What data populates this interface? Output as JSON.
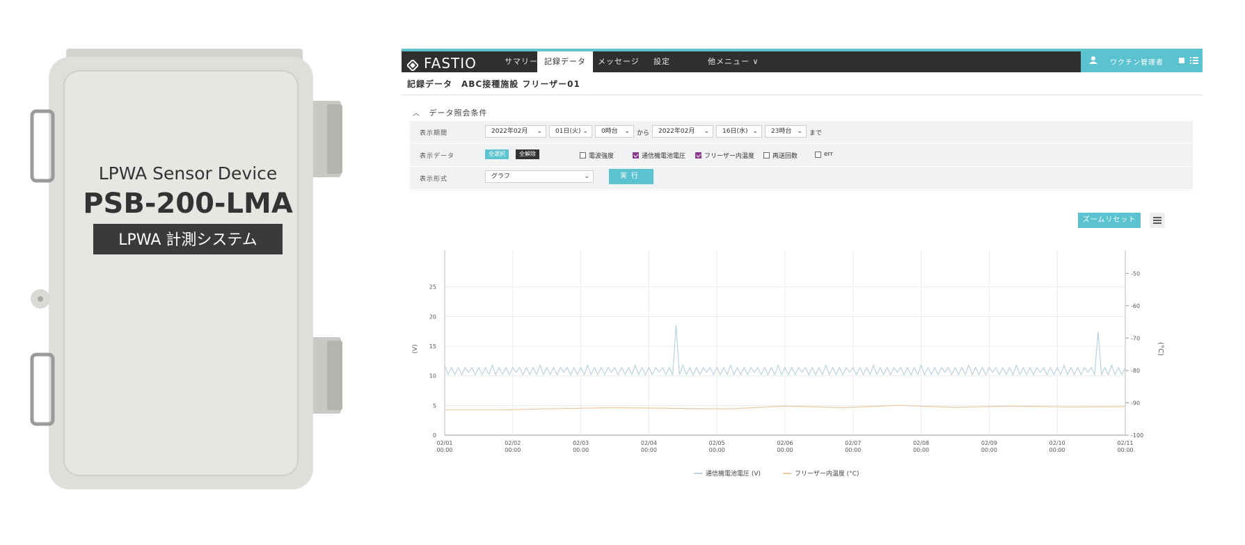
{
  "device": {
    "line1": "LPWA Sensor Device",
    "model": "PSB-200-LMA",
    "banner": "LPWA 計測システム",
    "colors": {
      "body": "#e2e2df",
      "banner": "#3a3a3a"
    }
  },
  "app": {
    "logo": "FASTIO",
    "nav": [
      {
        "label": "サマリー",
        "active": false
      },
      {
        "label": "記録データ",
        "active": true
      },
      {
        "label": "メッセージ",
        "active": false
      },
      {
        "label": "設定",
        "active": false
      },
      {
        "label": "他メニュー ∨",
        "active": false
      }
    ],
    "user": "ワクチン管理者",
    "breadcrumb": "記録データ　ABC接種施設 フリーザー01",
    "conditions_header": "データ照会条件",
    "period": {
      "label": "表示期間",
      "from_month": "2022年02月",
      "from_day": "01日(火)",
      "from_hour": "0時台",
      "from_sep": "から",
      "to_month": "2022年02月",
      "to_day": "16日(水)",
      "to_hour": "23時台",
      "to_sep": "まで"
    },
    "data_row": {
      "label": "表示データ",
      "select_all": "全選択",
      "clear_all": "全解除",
      "checks": [
        {
          "label": "電波強度",
          "checked": false
        },
        {
          "label": "通信機電池電圧",
          "checked": true
        },
        {
          "label": "フリーザー内温度",
          "checked": true
        },
        {
          "label": "再送回数",
          "checked": false
        },
        {
          "label": "err",
          "checked": false
        }
      ]
    },
    "format_row": {
      "label": "表示形式",
      "value": "グラフ",
      "run": "実行"
    },
    "zoom_reset": "ズームリセット",
    "colors": {
      "accent": "#5bc2cf",
      "topbar": "#2f2f2f",
      "checkbox": "#8a3b8f"
    }
  },
  "chart_data": {
    "type": "line",
    "x": [
      "02/01 00:00",
      "02/02 00:00",
      "02/03 00:00",
      "02/04 00:00",
      "02/05 00:00",
      "02/06 00:00",
      "02/07 00:00",
      "02/08 00:00",
      "02/09 00:00",
      "02/10 00:00",
      "02/11 00:00"
    ],
    "y_left": {
      "label": "(V)",
      "ticks": [
        "0",
        "5",
        "10",
        "15",
        "20",
        "25"
      ],
      "range": [
        0,
        30
      ]
    },
    "y_right": {
      "label": "(°C)",
      "ticks": [
        "-100",
        "-90",
        "-80",
        "-70",
        "-60",
        "-50"
      ],
      "range": [
        -100,
        -45
      ]
    },
    "series": [
      {
        "name": "通信機電池電圧 (V)",
        "axis": "left",
        "color": "#b9d3de",
        "baseline": 10.8,
        "spikes": [
          {
            "x": 3.4,
            "y": 18.5
          },
          {
            "x": 9.6,
            "y": 17.5
          }
        ]
      },
      {
        "name": "フリーザー内温度 (°C)",
        "axis": "right",
        "color": "#eac9a2",
        "values": [
          -92.2,
          -92.2,
          -91.8,
          -91.5,
          -91.7,
          -91.9,
          -91.0,
          -91.5,
          -90.8,
          -91.4,
          -91.0,
          -91.3,
          -91.2
        ]
      }
    ],
    "legend": [
      "通信機電池電圧 (V)",
      "フリーザー内温度 (°C)"
    ],
    "legend_position": "bottom",
    "grid": true
  }
}
